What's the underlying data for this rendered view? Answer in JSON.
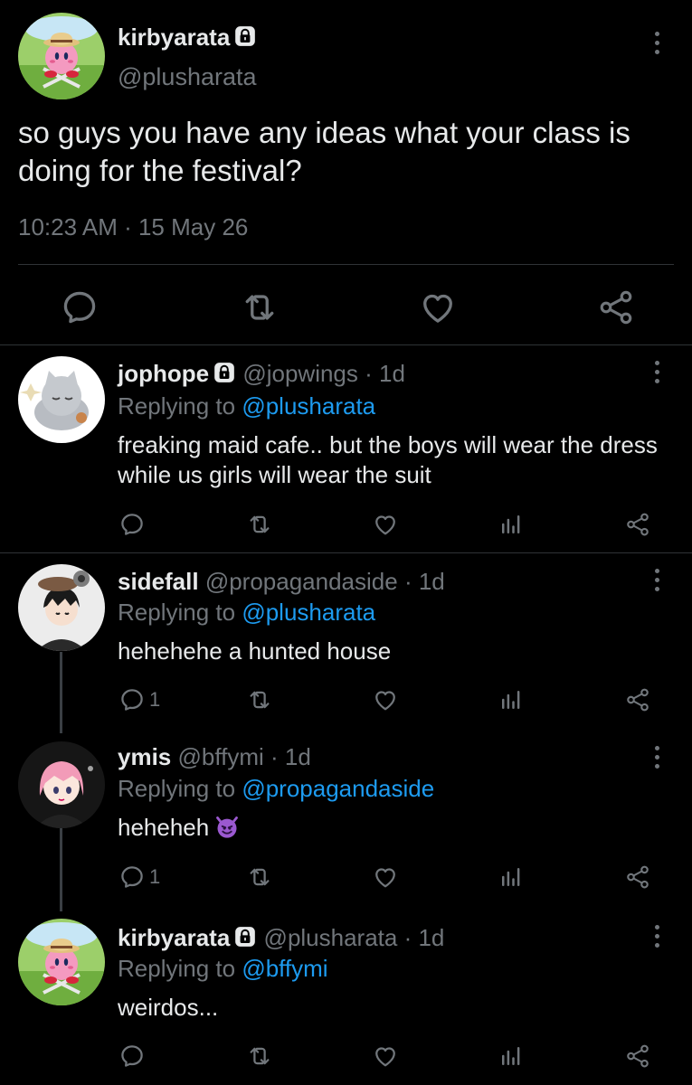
{
  "main_tweet": {
    "name": "kirbyarata",
    "handle": "@plusharata",
    "text": "so guys you have any ideas what your class is doing for the festival?",
    "timestamp": "10:23 AM · 15 May 26"
  },
  "replies": [
    {
      "name": "jophope",
      "handle": "@jopwings",
      "age": "· 1d",
      "replying_prefix": "Replying to ",
      "replying_to": "@plusharata",
      "text": "freaking maid cafe.. but the boys will wear the dress while us girls will wear the suit",
      "reply_count": ""
    },
    {
      "name": "sidefall",
      "handle": "@propagandaside",
      "age": "· 1d",
      "replying_prefix": "Replying to ",
      "replying_to": "@plusharata",
      "text": "hehehehe a hunted house",
      "reply_count": "1"
    },
    {
      "name": "ymis",
      "handle": "@bffymi",
      "age": "· 1d",
      "replying_prefix": "Replying to ",
      "replying_to": "@propagandaside",
      "text": "heheheh",
      "reply_count": "1"
    },
    {
      "name": "kirbyarata",
      "handle": "@plusharata",
      "age": "· 1d",
      "replying_prefix": "Replying to ",
      "replying_to": "@bffymi",
      "text": "weirdos...",
      "reply_count": ""
    }
  ],
  "icons": {
    "reply": "reply-icon",
    "retweet": "retweet-icon",
    "like": "heart-icon",
    "views": "analytics-icon",
    "share": "share-icon",
    "more": "more-vertical-icon",
    "lock": "lock-icon"
  },
  "colors": {
    "background": "#000000",
    "text": "#e7e9ea",
    "secondary": "#71767b",
    "link": "#1d9bf0",
    "divider": "#2f3336"
  }
}
